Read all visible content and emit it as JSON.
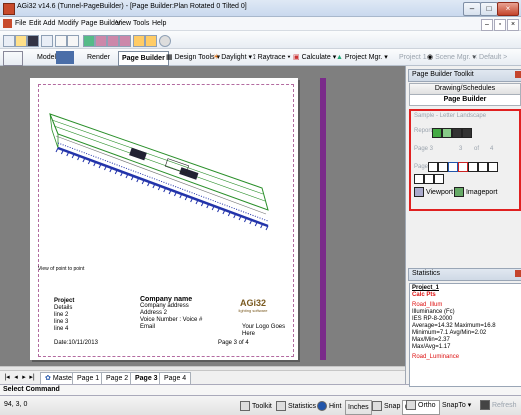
{
  "window": {
    "title": "AGi32 v14.6 (Tunnel-PageBuilder) - [Page Builder:Plan Rotated 0 Tilted 0]"
  },
  "menu": [
    "File",
    "Edit",
    "Add",
    "Modify",
    "Page Builder",
    "View",
    "Tools",
    "Help"
  ],
  "modes": {
    "model": "Model",
    "render": "Render",
    "page_builder": "Page Builder"
  },
  "toolbar": {
    "design_tools": "Design Tools",
    "daylight": "Daylight",
    "raytrace": "Raytrace",
    "calculate": "Calculate",
    "project_mgr": "Project Mgr.",
    "project_dd": "Project 1",
    "scene_mgr": "Scene Mgr.",
    "scene_dd": "< Default >"
  },
  "page": {
    "view_caption": "View of point to point",
    "project": {
      "heading": "Project",
      "lines": [
        "Details",
        "line 2",
        "line 3",
        "line 4"
      ]
    },
    "company": {
      "heading": "Company name",
      "lines": [
        "Company address",
        "Address 2",
        "Voice Number : Voice #",
        "Email"
      ]
    },
    "logo_text": "AGi32",
    "logo_sub": "lighting software",
    "logo_caption": "Your Logo Goes Here",
    "date": "Date:10/11/2013",
    "page_of": "Page 3 of 4"
  },
  "page_tabs": [
    "Master",
    "Page 1",
    "Page 2",
    "Page 3",
    "Page 4"
  ],
  "command": {
    "label": "Select Command",
    "coords": "94, 3, 0"
  },
  "status": {
    "toolkit": "Toolkit",
    "statistics": "Statistics",
    "hint": "Hint",
    "inches": "Inches",
    "snap": "Snap",
    "snap_val": "0.1",
    "ortho": "Ortho",
    "snapto": "SnapTo",
    "refresh": "Refresh"
  },
  "panel": {
    "title": "Page Builder Toolkit",
    "drawing_schedules": "Drawing/Schedules",
    "page_builder": "Page Builder",
    "template": "Sample - Letter Landscape",
    "report": "Report",
    "page_label": "Page 3",
    "page_total": "3",
    "of": "of",
    "page_count": "4",
    "page_tools": "Page",
    "viewport": "Viewport",
    "imageport": "Imageport"
  },
  "stats": {
    "title": "Statistics",
    "lines": [
      "Project_1",
      "Calc Pts",
      "Road_Illum",
      "Illuminance (Fc)",
      "IES RP-8-2000",
      "Average=14.32  Maximum=16.8  Minimum=7.1  Avg/Min=2.02  Max/Min=2.37",
      "Max/Avg=1.17",
      "Road_Luminance"
    ]
  },
  "colors": {
    "accent": "#e02020",
    "tunnel": "#2a8f2a",
    "lights": "#2233aa"
  }
}
